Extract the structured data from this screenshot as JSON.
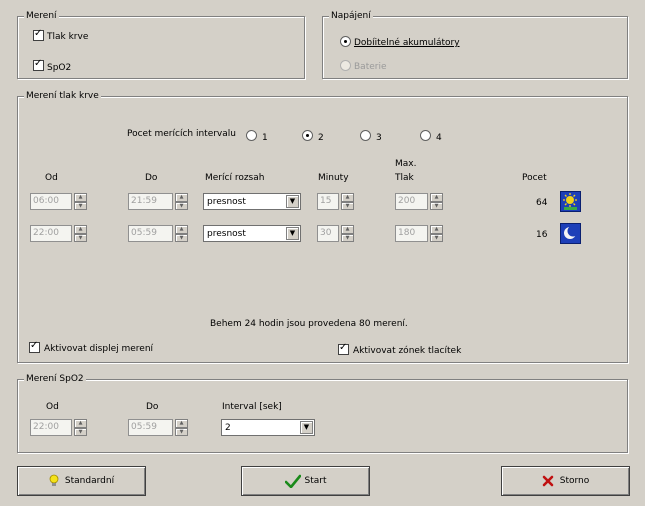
{
  "mereni": {
    "title": "Merení",
    "tlak_label": "Tlak krve",
    "spo2_label": "SpO2"
  },
  "napajeni": {
    "title": "Napájení",
    "option1": "Dobíitelné akumulátory",
    "option2": "Baterie"
  },
  "tlak": {
    "title": "Merení tlak krve",
    "interval_label": "Pocet merících intervalu",
    "radio_labels": [
      "1",
      "2",
      "3",
      "4"
    ],
    "col_od": "Od",
    "col_do": "Do",
    "col_rozsah": "Merící rozsah",
    "col_minuty": "Minuty",
    "col_max": "Max.",
    "col_tlak": "Tlak",
    "col_pocet": "Pocet",
    "rows": [
      {
        "od": "06:00",
        "do": "21:59",
        "rozsah": "presnost",
        "minuty": "15",
        "max": "200",
        "pocet": "64",
        "icon": "sun-icon"
      },
      {
        "od": "22:00",
        "do": "05:59",
        "rozsah": "presnost",
        "minuty": "30",
        "max": "180",
        "pocet": "16",
        "icon": "moon-icon"
      }
    ],
    "summary": "Behem 24 hodin jsou provedena 80 merení.",
    "displej_label": "Aktivovat displej merení",
    "zvonek_label": "Aktivovat zónek tlacítek"
  },
  "spo2": {
    "title": "Merení SpO2",
    "col_od": "Od",
    "col_do": "Do",
    "col_interval": "Interval [sek]",
    "od": "22:00",
    "do": "05:59",
    "interval": "2"
  },
  "buttons": {
    "standard": "Standardní",
    "start": "Start",
    "cancel": "Storno"
  },
  "spin_up": "▲",
  "spin_down": "▼",
  "combo_arrow": "▼",
  "colors": {
    "face": "#d4d0c8",
    "accent_blue": "#1d3fb8",
    "check_green": "#1a8a1a",
    "cancel_red": "#c01010"
  }
}
